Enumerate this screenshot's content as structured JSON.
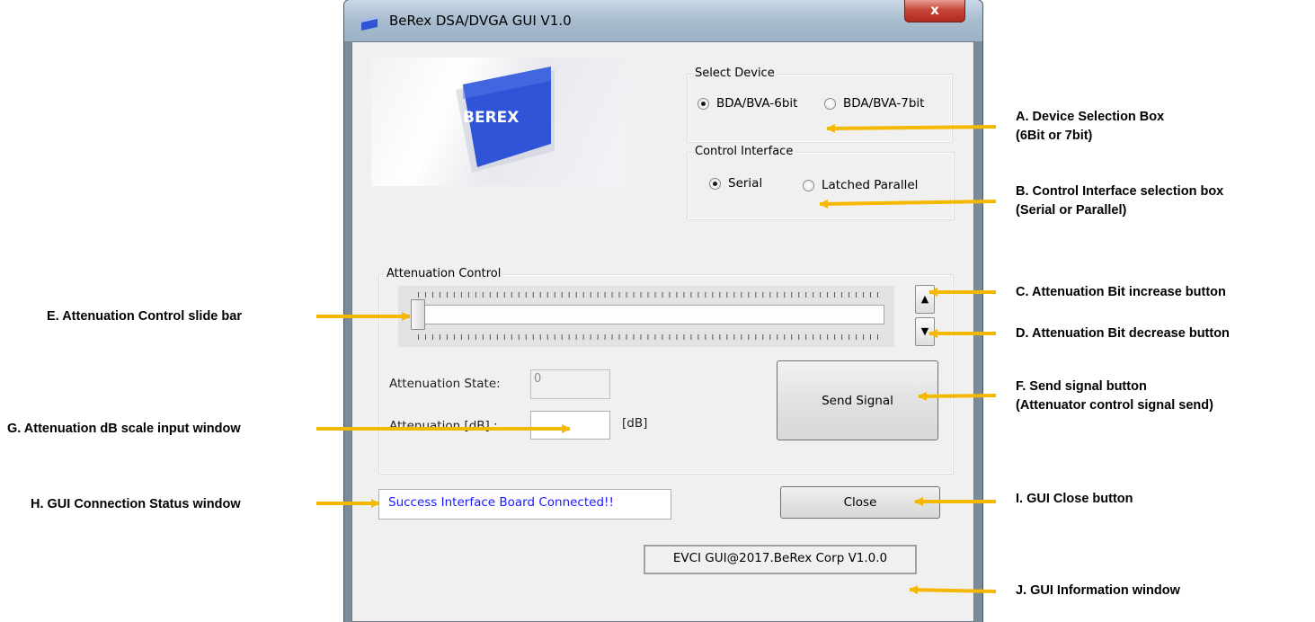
{
  "window": {
    "title": "BeRex DSA/DVGA GUI V1.0",
    "close_glyph": "x"
  },
  "logo": {
    "text": "BEREX"
  },
  "select_device": {
    "label": "Select Device",
    "options": [
      {
        "label": "BDA/BVA-6bit",
        "selected": true
      },
      {
        "label": "BDA/BVA-7bit",
        "selected": false
      }
    ]
  },
  "control_interface": {
    "label": "Control Interface",
    "options": [
      {
        "label": "Serial",
        "selected": true
      },
      {
        "label": "Latched Parallel",
        "selected": false
      }
    ]
  },
  "attenuation_control": {
    "label": "Attenuation Control",
    "slider_fraction": 0,
    "increase_glyph": "▲",
    "decrease_glyph": "▼",
    "state_label": "Attenuation State:",
    "state_value": "0",
    "db_label": "Attenuation [dB] :",
    "db_value": "",
    "db_unit": "[dB]",
    "send_button": "Send Signal"
  },
  "status": {
    "text": "Success Interface Board Connected!!",
    "color": "#1a1aff"
  },
  "close_button": "Close",
  "info": {
    "text": "EVCI GUI@2017.BeRex Corp V1.0.0"
  },
  "annotations": {
    "a_line1": "A. Device Selection Box",
    "a_line2": "(6Bit or 7bit)",
    "b_line1": "B. Control Interface selection box",
    "b_line2": "(Serial or Parallel)",
    "c": "C. Attenuation Bit increase button",
    "d": "D. Attenuation Bit decrease button",
    "e": "E. Attenuation Control slide bar",
    "f_line1": "F. Send signal button",
    "f_line2": "(Attenuator control signal send)",
    "g": "G. Attenuation dB scale input window",
    "h": "H. GUI Connection Status window",
    "i": "I. GUI Close button",
    "j": "J. GUI Information window"
  },
  "colors": {
    "arrow": "#f5b800",
    "logo_blue": "#2f54d8"
  }
}
